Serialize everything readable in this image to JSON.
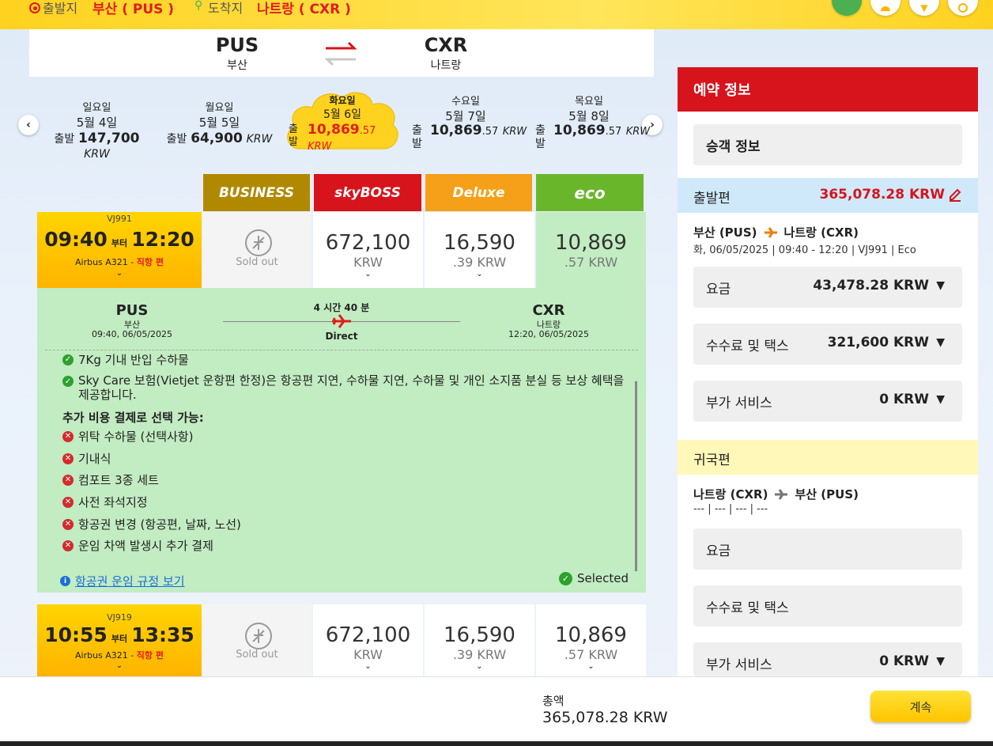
{
  "topbar": {
    "origin_label": "출발지",
    "origin_value": "부산 ( PUS )",
    "dest_label": "도착지",
    "dest_value": "나트랑 ( CXR )"
  },
  "route": {
    "from_code": "PUS",
    "from_city": "부산",
    "to_code": "CXR",
    "to_city": "나트랑"
  },
  "dates": [
    {
      "weekday": "일요일",
      "date": "5월 4일",
      "prefix": "출발",
      "price": "147,700",
      "decimal": "",
      "currency": "KRW"
    },
    {
      "weekday": "월요일",
      "date": "5월 5일",
      "prefix": "출발",
      "price": "64,900",
      "decimal": "",
      "currency": "KRW"
    },
    {
      "weekday": "화요일",
      "date": "5월 6일",
      "prefix": "출발",
      "price": "10,869",
      "decimal": ".57",
      "currency": "KRW"
    },
    {
      "weekday": "수요일",
      "date": "5월 7일",
      "prefix": "출발",
      "price": "10,869",
      "decimal": ".57",
      "currency": "KRW"
    },
    {
      "weekday": "목요일",
      "date": "5월 8일",
      "prefix": "출발",
      "price": "10,869",
      "decimal": ".57",
      "currency": "KRW"
    }
  ],
  "fare_classes": [
    {
      "label": "BUSINESS",
      "color": "#b08900"
    },
    {
      "label": "skyBOSS",
      "color": "#d7141c"
    },
    {
      "label": "Deluxe",
      "color": "#f5a018"
    },
    {
      "label": "eco",
      "color": "#69b62b"
    }
  ],
  "flights": [
    {
      "number": "VJ991",
      "depart": "09:40",
      "sep": "부터",
      "arrive": "12:20",
      "aircraft": "Airbus A321 -",
      "direct": "직항 편",
      "sold_out": "Sold out",
      "skyboss": {
        "main": "672,100",
        "sub": "KRW"
      },
      "deluxe": {
        "main": "16,590",
        "sub": ".39 KRW"
      },
      "eco": {
        "main": "10,869",
        "sub": ".57 KRW"
      }
    },
    {
      "number": "VJ919",
      "depart": "10:55",
      "sep": "부터",
      "arrive": "13:35",
      "aircraft": "Airbus A321 -",
      "direct": "직항 편",
      "sold_out": "Sold out",
      "skyboss": {
        "main": "672,100",
        "sub": "KRW"
      },
      "deluxe": {
        "main": "16,590",
        "sub": ".39 KRW"
      },
      "eco": {
        "main": "10,869",
        "sub": ".57 KRW"
      }
    }
  ],
  "detail": {
    "from_code": "PUS",
    "from_city": "부산",
    "from_time": "09:40, 06/05/2025",
    "duration": "4 시간 40 분",
    "direct": "Direct",
    "to_code": "CXR",
    "to_city": "나트랑",
    "to_time": "12:20, 06/05/2025",
    "included": [
      "7Kg 기내 반입 수하물",
      "Sky Care 보험(Vietjet 운항편 한정)은 항공편 지연, 수하물 지연, 수하물 및 개인 소지품 분실 등 보상 혜택을 제공합니다."
    ],
    "extra_title": "추가 비용 결제로 선택 가능:",
    "extras": [
      "위탁 수하물 (선택사항)",
      "기내식",
      "컴포트 3종 세트",
      "사전 좌석지정",
      "항공권 변경 (항공편, 날짜, 노선)",
      "운임 차액 발생시 추가 결제"
    ],
    "rules_link": "항공권 운임 규정 보기",
    "selected": "Selected"
  },
  "booking": {
    "title": "예약 정보",
    "passenger": "승객 정보",
    "outbound_label": "출발편",
    "outbound_total": "365,078.28 KRW",
    "outbound_route_from": "부산 (PUS)",
    "outbound_route_to": "나트랑 (CXR)",
    "outbound_info": "화, 06/05/2025 | 09:40 - 12:20 | VJ991 | Eco",
    "fare_label": "요금",
    "fare_value": "43,478.28 KRW",
    "tax_label": "수수료 및 택스",
    "tax_value": "321,600 KRW",
    "addon_label": "부가 서비스",
    "addon_value": "0 KRW",
    "return_label": "귀국편",
    "return_route_from": "나트랑 (CXR)",
    "return_route_to": "부산 (PUS)",
    "return_info": "--- | --- | --- | ---",
    "return_fare_label": "요금",
    "return_tax_label": "수수료 및 택스",
    "return_addon_label": "부가 서비스",
    "return_addon_value": "0 KRW"
  },
  "footer": {
    "total_label": "총액",
    "total_value": "365,078.28 KRW",
    "continue": "계속"
  }
}
